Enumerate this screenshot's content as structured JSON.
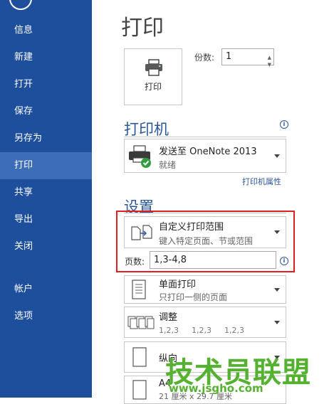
{
  "sidebar": {
    "items": [
      {
        "label": "信息"
      },
      {
        "label": "新建"
      },
      {
        "label": "打开"
      },
      {
        "label": "保存"
      },
      {
        "label": "另存为"
      },
      {
        "label": "打印"
      },
      {
        "label": "共享"
      },
      {
        "label": "导出"
      },
      {
        "label": "关闭"
      },
      {
        "label": "帐户"
      },
      {
        "label": "选项"
      }
    ],
    "active": "打印"
  },
  "main": {
    "title": "打印",
    "print_button": {
      "label": "打印"
    },
    "copies": {
      "label": "份数:",
      "value": "1"
    },
    "printer_section": {
      "title": "打印机",
      "printer_name": "发送至 OneNote 2013",
      "printer_status": "就绪",
      "properties_link": "打印机属性"
    },
    "settings_section": {
      "title": "设置",
      "range": {
        "title": "自定义打印范围",
        "subtitle": "键入特定页面、节或范围"
      },
      "pages": {
        "label": "页数:",
        "value": "1,3-4,8"
      },
      "sides": {
        "title": "单面打印",
        "subtitle": "只打印一侧的页面"
      },
      "collate": {
        "title": "调整",
        "sequence": [
          "1,2,3",
          "1,2,3",
          "1,2,3"
        ]
      },
      "orientation": {
        "title": "纵向"
      },
      "paper": {
        "title": "A4",
        "subtitle": "21 厘米 x 29.7 厘米"
      }
    }
  },
  "watermark": {
    "text": "技术员联盟",
    "url": "www.jsgho.com"
  },
  "colors": {
    "sidebar": "#1e4f9c",
    "sidebar_active": "#3d6db8",
    "accent": "#2b579a",
    "highlight": "#e02020",
    "watermark": "#55b130"
  },
  "icons": [
    "back-arrow-icon",
    "printer-icon",
    "info-icon",
    "printer-status-icon",
    "custom-range-icon",
    "one-sided-icon",
    "collate-icon",
    "portrait-icon",
    "paper-size-icon"
  ]
}
